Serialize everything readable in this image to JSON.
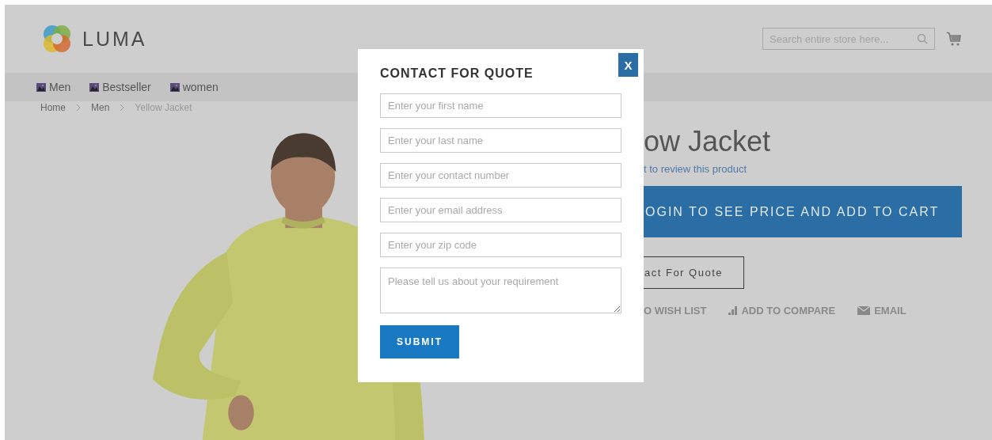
{
  "header": {
    "logo": "LUMA",
    "search": {
      "placeholder": "Search entire store here..."
    }
  },
  "nav": [
    {
      "label": "Men"
    },
    {
      "label": "Bestseller"
    },
    {
      "label": "women"
    }
  ],
  "breadcrumbs": [
    {
      "label": "Home",
      "current": false
    },
    {
      "label": "Men",
      "current": false
    },
    {
      "label": "Yellow Jacket",
      "current": true
    }
  ],
  "product": {
    "title": "ow Jacket",
    "review_link": "t to review this product",
    "cart_button": "OGIN TO SEE PRICE AND ADD TO CART",
    "quote_button": "act For Quote",
    "actions": [
      {
        "kind": "wishlist",
        "label": "O WISH LIST"
      },
      {
        "kind": "compare",
        "label": "ADD TO COMPARE"
      },
      {
        "kind": "email",
        "label": "EMAIL"
      }
    ]
  },
  "modal": {
    "title": "CONTACT FOR QUOTE",
    "close": "X",
    "fields": [
      {
        "kind": "input",
        "placeholder": "Enter your first name"
      },
      {
        "kind": "input",
        "placeholder": "Enter your last name"
      },
      {
        "kind": "input",
        "placeholder": "Enter your contact number"
      },
      {
        "kind": "input",
        "placeholder": "Enter your email address"
      },
      {
        "kind": "input",
        "placeholder": "Enter your zip code"
      },
      {
        "kind": "textarea",
        "placeholder": "Please tell us about your requirement"
      }
    ],
    "submit": "SUBMIT"
  }
}
